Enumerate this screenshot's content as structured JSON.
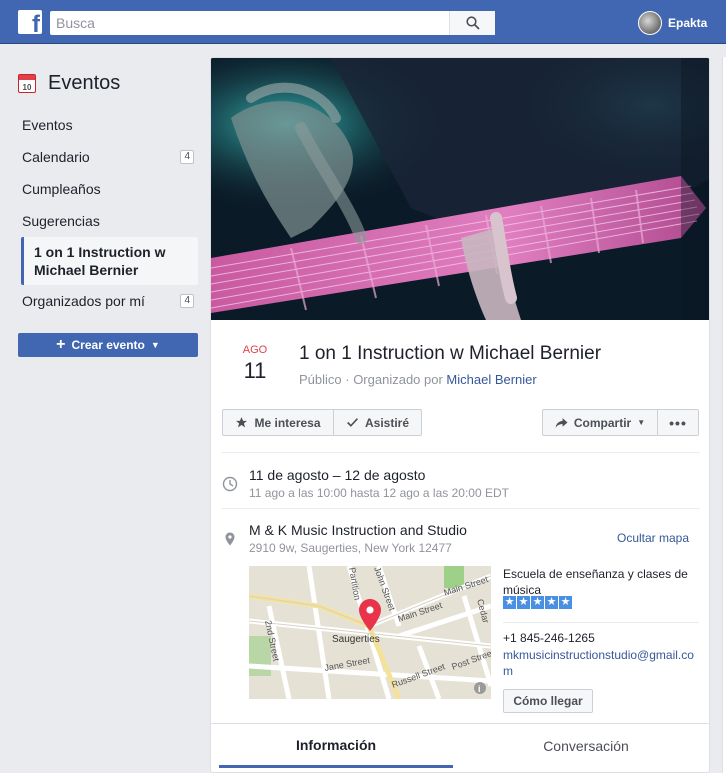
{
  "topbar": {
    "search_placeholder": "Busca",
    "user_name": "Epakta"
  },
  "sidebar": {
    "title": "Eventos",
    "calendar_icon_day": "10",
    "items": [
      {
        "label": "Eventos",
        "count": ""
      },
      {
        "label": "Calendario",
        "count": "4"
      },
      {
        "label": "Cumpleaños",
        "count": ""
      },
      {
        "label": "Sugerencias",
        "count": ""
      },
      {
        "label": "1 on 1 Instruction w Michael Bernier",
        "count": ""
      },
      {
        "label": "Organizados por mí",
        "count": "4"
      }
    ],
    "create_label": "Crear evento"
  },
  "event": {
    "month": "AGO",
    "day": "11",
    "title": "1 on 1 Instruction w Michael Bernier",
    "privacy": "Público · Organizado por ",
    "organizer": "Michael Bernier",
    "buttons": {
      "interested": "Me interesa",
      "attended": "Asistiré",
      "share": "Compartir"
    },
    "date_range": "11 de agosto – 12 de agosto",
    "time_detail": "11 ago a las 10:00 hasta 12 ago a las 20:00 EDT",
    "venue": "M & K Music Instruction and Studio",
    "address": "2910 9w, Saugerties, New York 12477",
    "hide_map": "Ocultar mapa",
    "map_labels": {
      "town": "Saugerties",
      "main_st": "Main Street",
      "main_st2": "Main Street",
      "partition": "Partition",
      "john": "John Street",
      "second": "2nd Street",
      "jane": "Jane Street",
      "russell": "Russell Street",
      "post": "Post Street",
      "cedar": "Cedar"
    },
    "business": {
      "description": "Escuela de enseñanza y clases de música",
      "rating": 5,
      "phone": "+1 845-246-1265",
      "website": "mkmusicinstructionstudio@gmail.com",
      "directions": "Cómo llegar"
    },
    "tabs": {
      "info": "Información",
      "conversation": "Conversación"
    }
  },
  "colors": {
    "brand": "#4267b2",
    "link": "#365899",
    "month_red": "#e04148",
    "star_blue": "#4a90e2"
  }
}
